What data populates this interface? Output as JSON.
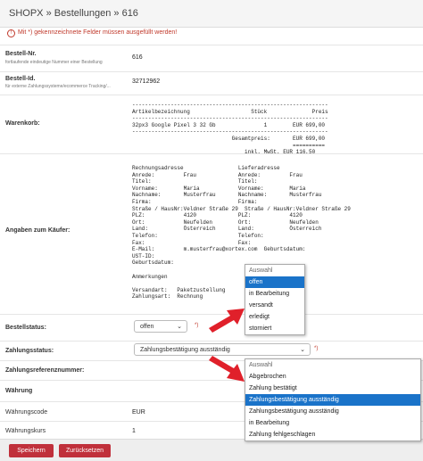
{
  "header": {
    "breadcrumb": "SHOPX » Bestellungen » 616"
  },
  "alert": {
    "text": "Mit *) gekennzeichnete Felder müssen ausgefüllt werden!"
  },
  "fields": {
    "bestell_nr": {
      "label": "Bestell-Nr.",
      "hint": "fortlaufende eindeutige Nummer einer Bestellung",
      "value": "616"
    },
    "bestell_id": {
      "label": "Bestell-Id.",
      "hint": "für externe Zahlungssysteme/ecommerce Tracking/...",
      "value": "32712962"
    },
    "warenkorb": {
      "label": "Warenkorb:"
    },
    "kaeufer": {
      "label": "Angaben zum Käufer:"
    },
    "bestellstatus": {
      "label": "Bestellstatus:",
      "value": "offen",
      "required": "*)"
    },
    "zahlungsstatus": {
      "label": "Zahlungsstatus:",
      "value": "Zahlungsbestätigung ausständig",
      "required": "*)"
    },
    "zahlungsreferenz": {
      "label": "Zahlungsreferenznummer:"
    }
  },
  "cart_text": "-------------------------------------------------------------\nArtikelbezeichnung                   Stück              Preis\n-------------------------------------------------------------\n32px3 Google Pixel 3 32 Gb               1        EUR 699,00\n-------------------------------------------------------------\n                               Gesamtpreis:       EUR 699,00\n                                                  ==========\n                                   inkl. MwSt. EUR 116,50",
  "buyer_text": "Rechnungsadresse                 Lieferadresse\nAnrede:         Frau             Anrede:         Frau\nTitel:                           Titel:\nVorname:        Maria            Vorname:        Maria\nNachname:       Musterfrau       Nachname:       Musterfrau\nFirma:                           Firma:\nStraße / HausNr:Veldner Straße 29  Straße / HausNr:Veldner Straße 29\nPLZ:            4120             PLZ:            4120\nOrt:            Neufelden        Ort:            Neufelden\nLand:           Österreich       Land:           Österreich\nTelefon:                         Telefon:\nFax:                             Fax:\nE-Mail:         m.musterfrau@xortex.com  Geburtsdatum:\nUST-ID:\nGeburtsdatum:\n\nAnmerkungen\n\nVersandart:   Paketzustellung\nZahlungsart:  Rechnung",
  "status_dropdown": {
    "header": "Auswahl",
    "options": [
      "offen",
      "in Bearbeitung",
      "versandt",
      "erledigt",
      "storniert"
    ],
    "highlighted": "offen"
  },
  "payment_dropdown": {
    "header": "Auswahl",
    "options": [
      "Abgebrochen",
      "Zahlung bestätigt",
      "Zahlungsbestätigung ausständig",
      "Zahlungsbestätigung ausständig",
      "in Bearbeitung",
      "Zahlung fehlgeschlagen"
    ],
    "highlighted_index": 2
  },
  "waehrung": {
    "section": "Währung",
    "code_label": "Währungscode",
    "code_value": "EUR",
    "kurs_label": "Währungskurs",
    "kurs_value": "1"
  },
  "footer": {
    "save": "Speichern",
    "reset": "Zurücksetzen"
  },
  "colors": {
    "accent": "#c0303b",
    "highlight": "#1a73c9",
    "arrow": "#e0202a"
  }
}
